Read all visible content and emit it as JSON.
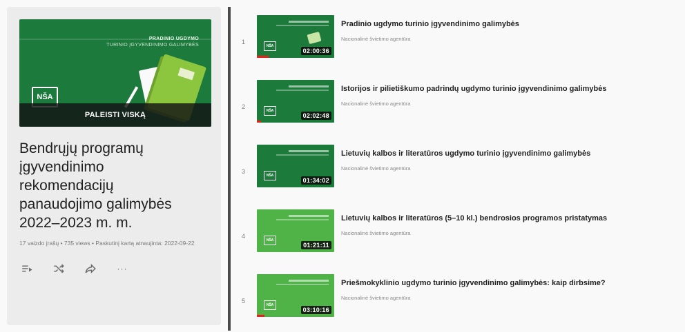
{
  "playlist": {
    "thumbnail_kicker": "PRADINIO UGDYMO",
    "thumbnail_kicker_sub": "TURINIO ĮGYVENDINIMO GALIMYBĖS",
    "thumbnail_logo": "NŠA",
    "play_all_label": "PALEISTI VISKĄ",
    "title": "Bendrųjų programų įgyvendinimo rekomendacijų panaudojimo galimybės 2022–2023 m. m.",
    "meta": "17 vaizdo įrašų • 735 views • Paskutinį kartą atnaujinta: 2022-09-22",
    "actions": [
      {
        "name": "add-to-queue-icon"
      },
      {
        "name": "shuffle-icon"
      },
      {
        "name": "share-icon"
      },
      {
        "name": "more-icon",
        "label": "···"
      }
    ]
  },
  "videos": [
    {
      "index": "1",
      "title": "Pradinio ugdymo turinio įgyvendinimo galimybės",
      "channel": "Nacionalinė švietimo agentūra",
      "duration": "02:00:36",
      "theme": "dark",
      "progress": 0.15
    },
    {
      "index": "2",
      "title": "Istorijos ir pilietiškumo padrindų ugdymo turinio įgyvendinimo galimybės",
      "channel": "Nacionalinė švietimo agentūra",
      "duration": "02:02:48",
      "theme": "dark",
      "progress": 0.05
    },
    {
      "index": "3",
      "title": "Lietuvių kalbos ir literatūros ugdymo turinio įgyvendinimo galimybės",
      "channel": "Nacionalinė švietimo agentūra",
      "duration": "01:34:02",
      "theme": "dark",
      "progress": 0
    },
    {
      "index": "4",
      "title": "Lietuvių kalbos ir literatūros (5–10 kl.) bendrosios programos pristatymas",
      "channel": "Nacionalinė švietimo agentūra",
      "duration": "01:21:11",
      "theme": "light",
      "progress": 0
    },
    {
      "index": "5",
      "title": "Priešmokyklinio ugdymo turinio įgyvendinimo galimybės: kaip dirbsime?",
      "channel": "Nacionalinė švietimo agentūra",
      "duration": "03:10:16",
      "theme": "light",
      "progress": 0.1
    }
  ],
  "colors": {
    "brand_green": "#1b7a3c",
    "light_green": "#4fb347",
    "progress_red": "#e5231b"
  }
}
